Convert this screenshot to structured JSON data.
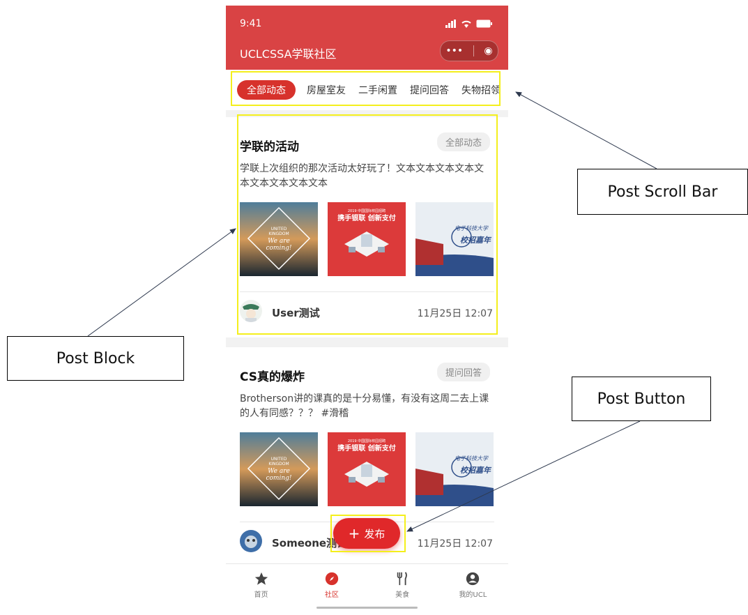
{
  "status_bar": {
    "time": "9:41"
  },
  "header": {
    "title": "UCLCSSA学联社区",
    "menu_dots": "•••",
    "close_symbol": "◉"
  },
  "tabs": [
    {
      "label": "全部动态",
      "active": true
    },
    {
      "label": "房屋室友",
      "active": false
    },
    {
      "label": "二手闲置",
      "active": false
    },
    {
      "label": "提问回答",
      "active": false
    },
    {
      "label": "失物招领",
      "active": false
    }
  ],
  "posts": [
    {
      "title": "学联的活动",
      "tag": "全部动态",
      "body": "学联上次组织的那次活动太好玩了！文本文本文本文本文本文本文本文本文本",
      "images": [
        {
          "kind": "united-kingdom-poster",
          "line1": "UNITED",
          "line2": "KINGDOM",
          "line3": "We are",
          "line4": "coming!"
        },
        {
          "kind": "fair-poster",
          "line1": "2019 中国国际校园招聘",
          "line2": "携手银联 创新支付"
        },
        {
          "kind": "university-poster",
          "line1": "电子科技大学",
          "line2": "校招嘉年"
        }
      ],
      "user": "User测试",
      "time": "11月25日 12:07"
    },
    {
      "title": "CS真的爆炸",
      "tag": "提问回答",
      "body": "Brotherson讲的课真的是十分易懂，有没有这周二去上课的人有同感？？？ #滑稽",
      "images": [
        {
          "kind": "united-kingdom-poster",
          "line1": "UNITED",
          "line2": "KINGDOM",
          "line3": "We are",
          "line4": "coming!"
        },
        {
          "kind": "fair-poster",
          "line1": "2019 中国国际校园招聘",
          "line2": "携手银联 创新支付"
        },
        {
          "kind": "university-poster",
          "line1": "电子科技大学",
          "line2": "校招嘉年"
        }
      ],
      "user": "Someone测试",
      "time": "11月25日 12:07"
    }
  ],
  "fab": {
    "label": "发布"
  },
  "nav": [
    {
      "label": "首页",
      "icon": "star-icon",
      "active": false
    },
    {
      "label": "社区",
      "icon": "compass-icon",
      "active": true
    },
    {
      "label": "美食",
      "icon": "fork-knife-icon",
      "active": false
    },
    {
      "label": "我的UCL",
      "icon": "user-circle-icon",
      "active": false
    }
  ],
  "annotations": {
    "scroll_bar": "Post Scroll Bar",
    "block": "Post Block",
    "button": "Post Button"
  },
  "colors": {
    "brand_red": "#d94344",
    "highlight": "#f4ef1c"
  }
}
